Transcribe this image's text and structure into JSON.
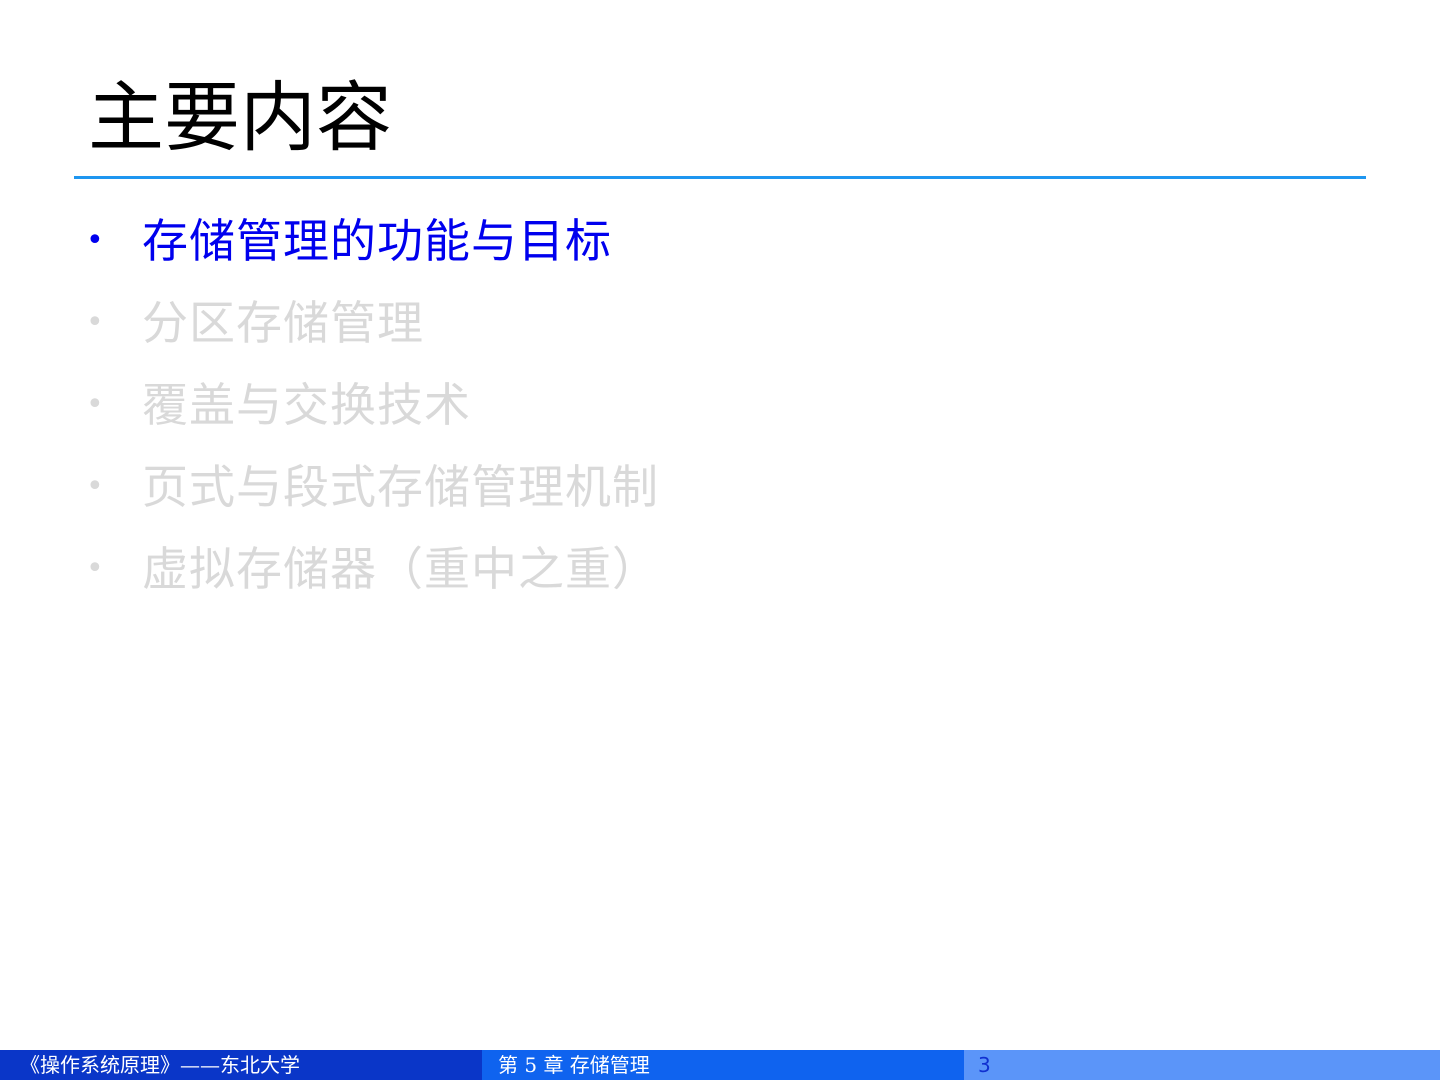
{
  "slide": {
    "title": "主要内容",
    "bullet_glyph": "•",
    "bullets": [
      {
        "text": "存储管理的功能与目标",
        "state": "active"
      },
      {
        "text": "分区存储管理",
        "state": "dimmed"
      },
      {
        "text": "覆盖与交换技术",
        "state": "dimmed"
      },
      {
        "text": "页式与段式存储管理机制",
        "state": "dimmed"
      },
      {
        "text": "虚拟存储器（重中之重）",
        "state": "dimmed"
      }
    ]
  },
  "footer": {
    "course": "《操作系统原理》——东北大学",
    "chapter": "第 5 章  存储管理",
    "page_number": "3"
  },
  "colors": {
    "title": "#000000",
    "rule": "#1e96f0",
    "active_text": "#0000ee",
    "dimmed_text": "#d9d9d9",
    "footer_left_bg": "#0a36c8",
    "footer_mid_bg": "#0f63ef",
    "footer_right_bg": "#5b95f9",
    "footer_text": "#ffffff",
    "page_number_text": "#1030d0"
  }
}
